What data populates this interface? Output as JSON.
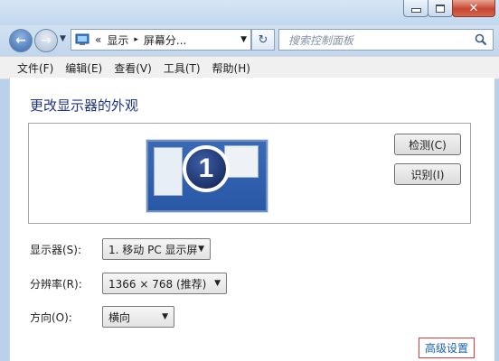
{
  "address": {
    "crumbs": [
      "«",
      "显示",
      "▸",
      "屏幕分..."
    ],
    "search_placeholder": "搜索控制面板"
  },
  "menu": [
    "文件(F)",
    "编辑(E)",
    "查看(V)",
    "工具(T)",
    "帮助(H)"
  ],
  "heading": "更改显示器的外观",
  "preview": {
    "monitor_number": "1"
  },
  "buttons": {
    "detect": "检测(C)",
    "identify": "识别(I)"
  },
  "fields": {
    "display": {
      "label": "显示器(S):",
      "value": "1. 移动 PC 显示屏"
    },
    "resolution": {
      "label": "分辨率(R):",
      "value": "1366 × 768 (推荐)"
    },
    "orientation": {
      "label": "方向(O):",
      "value": "横向"
    }
  },
  "advanced_link": "高级设置",
  "colors": {
    "accent_heading": "#1e3287",
    "link": "#1a5fb4",
    "highlight_box": "#e13a3a"
  }
}
